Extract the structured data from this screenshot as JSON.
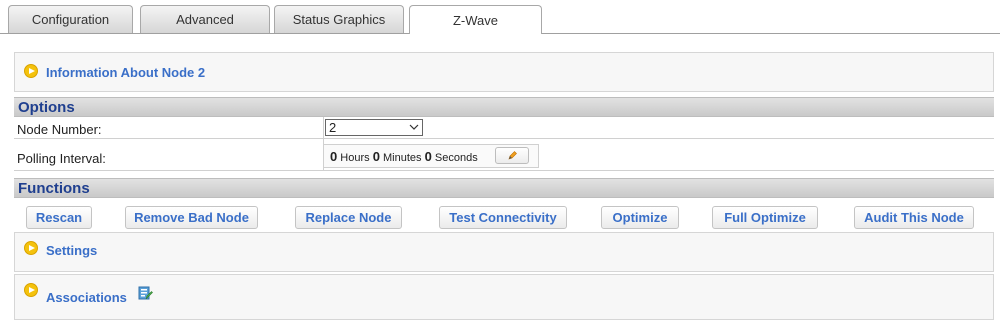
{
  "tabs": [
    {
      "label": "Configuration"
    },
    {
      "label": "Advanced"
    },
    {
      "label": "Status Graphics"
    },
    {
      "label": "Z-Wave",
      "active": true
    }
  ],
  "info_box": {
    "title": "Information About Node 2"
  },
  "options": {
    "header": "Options",
    "node_number": {
      "label": "Node Number:",
      "value": "2"
    },
    "polling_interval": {
      "label": "Polling Interval:",
      "hours": "0",
      "hours_unit": "Hours",
      "minutes": "0",
      "minutes_unit": "Minutes",
      "seconds": "0",
      "seconds_unit": "Seconds",
      "edit_icon": "pencil-icon"
    }
  },
  "functions": {
    "header": "Functions",
    "buttons": [
      "Rescan",
      "Remove Bad Node",
      "Replace Node",
      "Test Connectivity",
      "Optimize",
      "Full Optimize",
      "Audit This Node"
    ]
  },
  "settings_box": {
    "title": "Settings"
  },
  "associations_box": {
    "title": "Associations",
    "icon": "edit-document-icon"
  },
  "colors": {
    "link_blue": "#3a6fc8",
    "header_blue": "#1f3f8f",
    "icon_yellow": "#f4c20d"
  }
}
